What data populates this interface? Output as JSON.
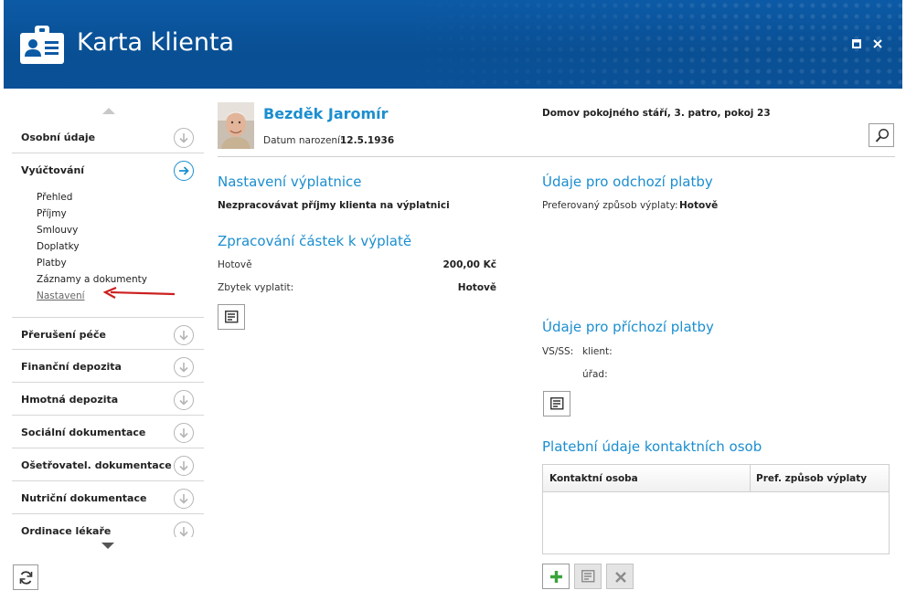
{
  "header": {
    "title": "Karta klienta",
    "background": "#0b5aa5"
  },
  "sidebar": {
    "items": [
      {
        "label": "Osobní údaje"
      },
      {
        "label": "Vyúčtování"
      },
      {
        "label": "Přerušení péče"
      },
      {
        "label": "Finanční depozita"
      },
      {
        "label": "Hmotná depozita"
      },
      {
        "label": "Sociální dokumentace"
      },
      {
        "label": "Ošetřovatel. dokumentace"
      },
      {
        "label": "Nutriční dokumentace"
      },
      {
        "label": "Ordinace lékaře"
      }
    ],
    "subitems": [
      "Přehled",
      "Příjmy",
      "Smlouvy",
      "Doplatky",
      "Platby",
      "Záznamy a dokumenty",
      "Nastavení"
    ],
    "active_color": "#1b8fd0"
  },
  "client": {
    "name": "Bezděk Jaromír",
    "dob_label": "Datum narození:",
    "dob_value": "12.5.1936",
    "location": "Domov pokojného stáří, 3. patro, pokoj 23"
  },
  "payout_settings": {
    "title": "Nastavení výplatnice",
    "text": "Nezpracovávat příjmy klienta na výplatnici"
  },
  "processing": {
    "title": "Zpracování částek k výplatě",
    "rows": [
      {
        "label": "Hotově",
        "value": "200,00 Kč"
      },
      {
        "label": "Zbytek vyplatit:",
        "value": "Hotově"
      }
    ]
  },
  "outgoing": {
    "title": "Údaje pro odchozí platby",
    "label": "Preferovaný způsob výplaty:",
    "value": "Hotově"
  },
  "incoming": {
    "title": "Údaje pro příchozí platby",
    "vs_label": "VS/SS:",
    "client_label": "klient:",
    "office_label": "úřad:"
  },
  "contacts": {
    "title": "Platební údaje kontaktních osob",
    "columns": [
      "Kontaktní osoba",
      "Pref. způsob výplaty"
    ]
  },
  "colors": {
    "accent": "#1b8ecf",
    "add_green": "#3aa43a",
    "annotation_arrow": "#cc1f1f"
  }
}
